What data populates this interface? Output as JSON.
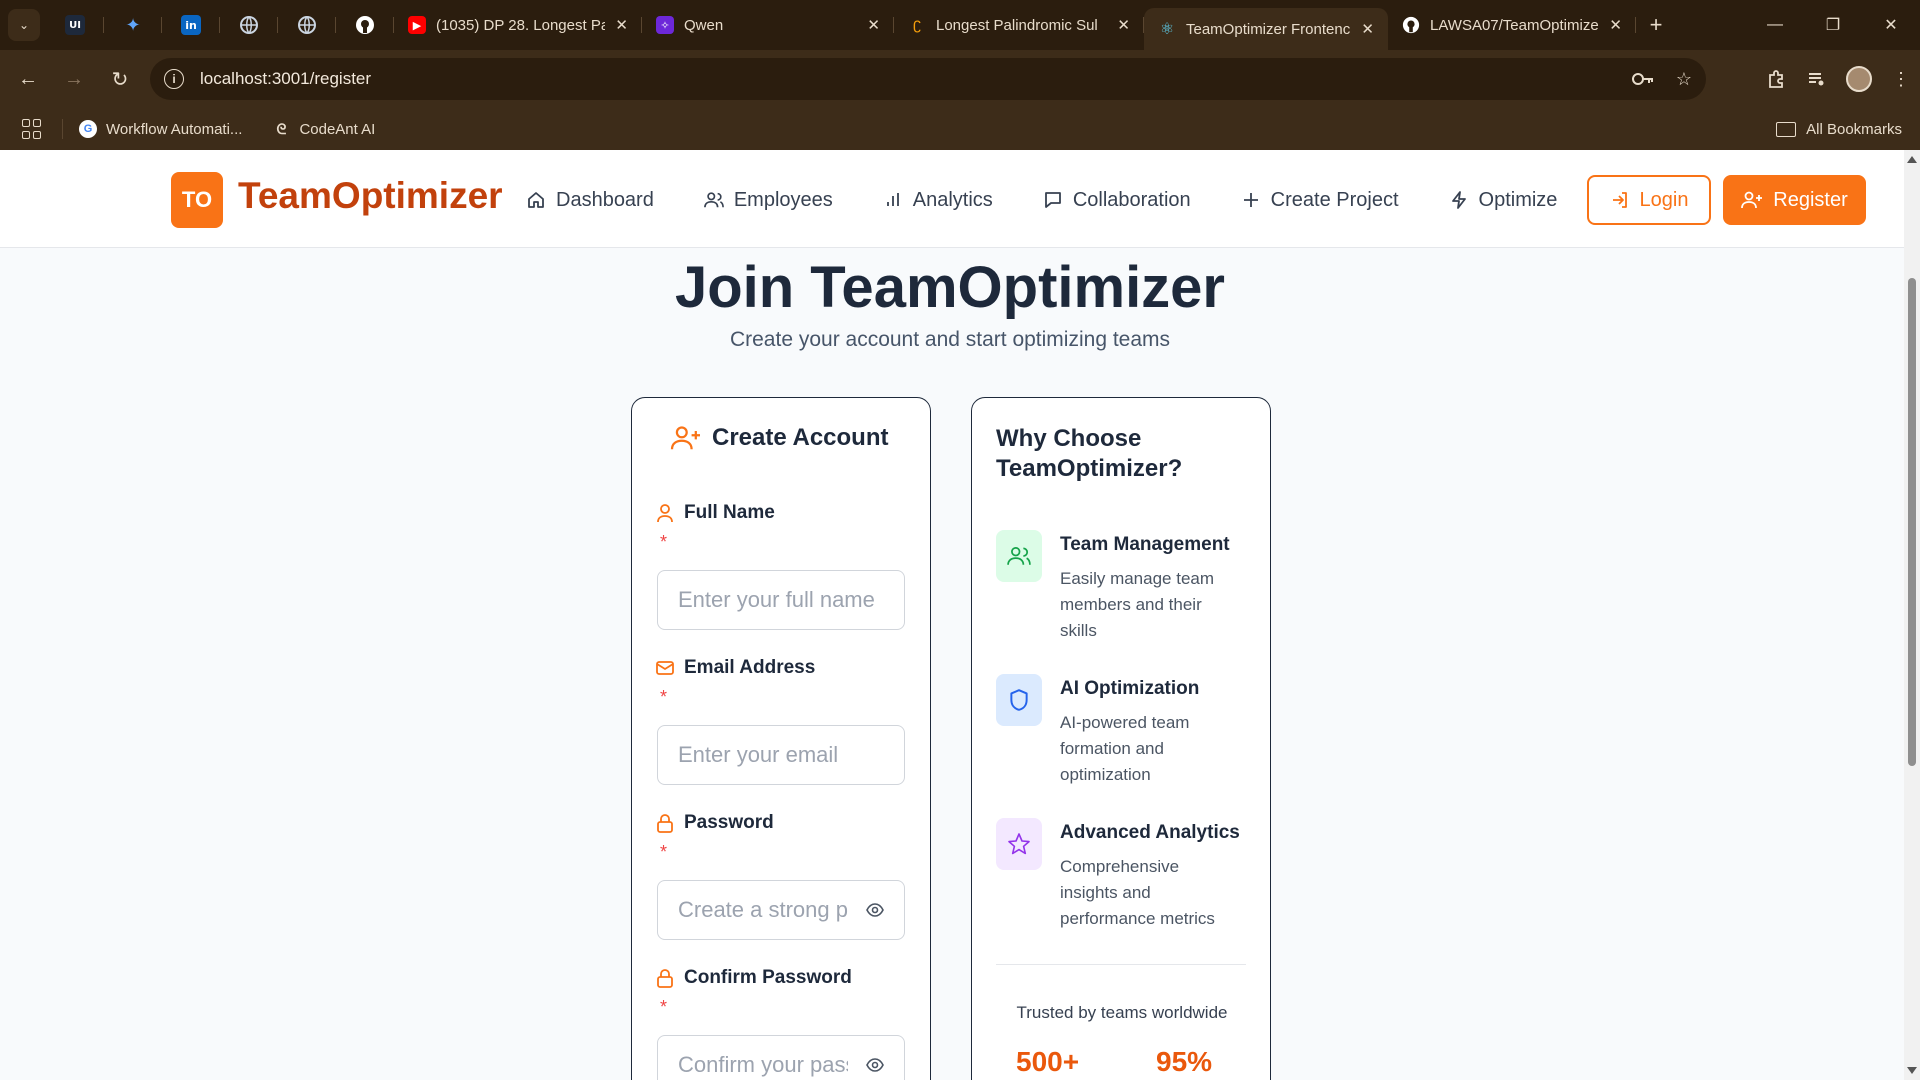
{
  "browser": {
    "pinned_tabs": [
      {
        "icon": "ui-icon",
        "label": "UI",
        "color": "#1e293b"
      },
      {
        "icon": "sparkle-icon",
        "label": "✦",
        "color": "#3b82f6"
      },
      {
        "icon": "linkedin-icon",
        "label": "in",
        "color": "#0a66c2"
      },
      {
        "icon": "globe-icon",
        "label": "",
        "color": "#94a3b8"
      },
      {
        "icon": "globe-icon",
        "label": "",
        "color": "#94a3b8"
      },
      {
        "icon": "github-icon",
        "label": "",
        "color": "#ffffff"
      }
    ],
    "tabs": [
      {
        "title": "(1035) DP 28. Longest Pa",
        "icon": "youtube-icon",
        "active": false
      },
      {
        "title": "Qwen",
        "icon": "qwen-icon",
        "active": false
      },
      {
        "title": "Longest Palindromic Sul",
        "icon": "leetcode-icon",
        "active": false
      },
      {
        "title": "TeamOptimizer Frontenc",
        "icon": "react-icon",
        "active": true
      },
      {
        "title": "LAWSA07/TeamOptimize",
        "icon": "github-icon",
        "active": false
      }
    ],
    "url": "localhost:3001/register",
    "bookmarks": [
      {
        "label": "Workflow Automati...",
        "icon": "google-icon"
      },
      {
        "label": "CodeAnt AI",
        "icon": "codeant-icon"
      }
    ],
    "all_bookmarks": "All Bookmarks"
  },
  "header": {
    "logo_mark": "TO",
    "logo_text": "TeamOptimizer",
    "nav": [
      {
        "label": "Dashboard",
        "icon": "home-icon"
      },
      {
        "label": "Employees",
        "icon": "users-icon"
      },
      {
        "label": "Analytics",
        "icon": "bar-chart-icon"
      },
      {
        "label": "Collaboration",
        "icon": "message-icon"
      },
      {
        "label": "Create Project",
        "icon": "plus-icon"
      },
      {
        "label": "Optimize",
        "icon": "zap-icon"
      }
    ],
    "login_label": "Login",
    "register_label": "Register"
  },
  "hero": {
    "title": "Join TeamOptimizer",
    "subtitle": "Create your account and start optimizing teams"
  },
  "form": {
    "title": "Create Account",
    "required_mark": "*",
    "fields": [
      {
        "label": "Full Name",
        "placeholder": "Enter your full name",
        "icon": "user-icon",
        "type": "text"
      },
      {
        "label": "Email Address",
        "placeholder": "Enter your email",
        "icon": "mail-icon",
        "type": "email"
      },
      {
        "label": "Password",
        "placeholder": "Create a strong password",
        "icon": "lock-icon",
        "type": "password"
      },
      {
        "label": "Confirm Password",
        "placeholder": "Confirm your password",
        "icon": "lock-icon",
        "type": "password"
      }
    ]
  },
  "why": {
    "title": "Why Choose TeamOptimizer?",
    "features": [
      {
        "title": "Team Management",
        "description": "Easily manage team members and their skills",
        "icon": "users-icon",
        "bg": "#dcfce7",
        "fg": "#16a34a"
      },
      {
        "title": "AI Optimization",
        "description": "AI-powered team formation and optimization",
        "icon": "shield-icon",
        "bg": "#dbeafe",
        "fg": "#2563eb"
      },
      {
        "title": "Advanced Analytics",
        "description": "Comprehensive insights and performance metrics",
        "icon": "star-icon",
        "bg": "#f3e8ff",
        "fg": "#9333ea"
      }
    ],
    "trusted_text": "Trusted by teams worldwide",
    "stats": [
      "500+",
      "95%"
    ]
  },
  "colors": {
    "accent": "#f97316",
    "brand_text": "#c2410c",
    "chrome_bg": "#2b1d0e"
  }
}
